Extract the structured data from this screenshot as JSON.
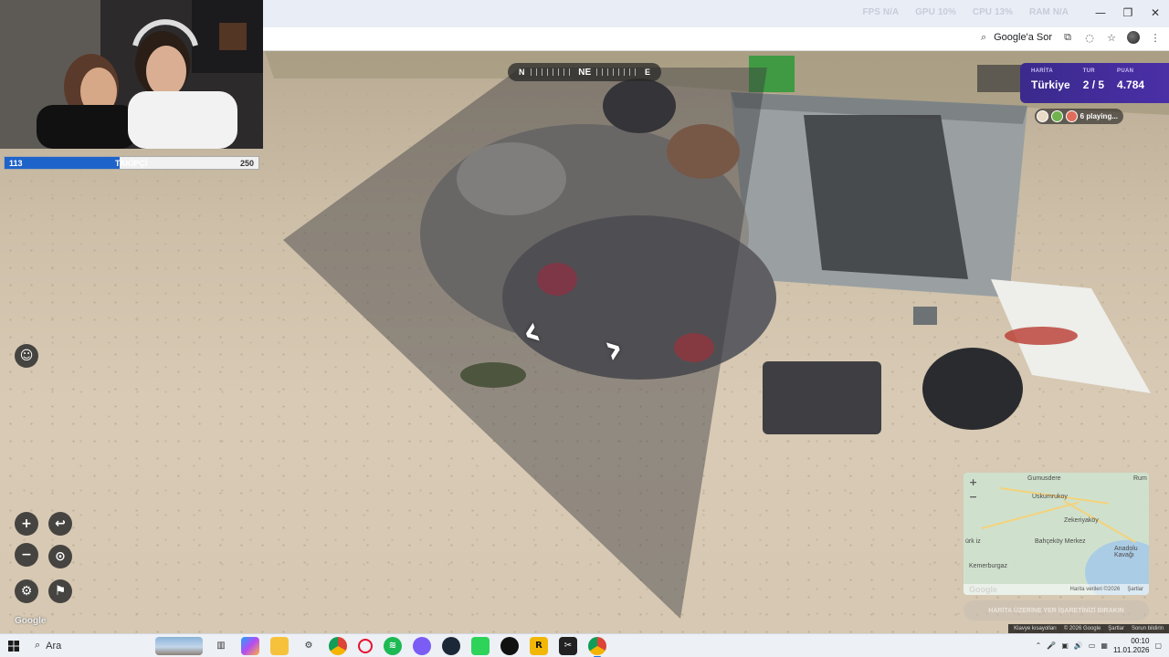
{
  "browser": {
    "perf": [
      {
        "label": "FPS",
        "value": "N/A"
      },
      {
        "label": "GPU",
        "value": "10%"
      },
      {
        "label": "CPU",
        "value": "13%"
      },
      {
        "label": "RAM",
        "value": "N/A"
      }
    ],
    "ask_google": "Google'a Sor"
  },
  "game": {
    "compass": {
      "left": "N",
      "center": "NE",
      "right": "E"
    },
    "score": {
      "map_label": "HARİTA",
      "map_value": "Türkiye",
      "round_label": "TUR",
      "round_value": "2 / 5",
      "points_label": "PUAN",
      "points_value": "4.784"
    },
    "playing": "6 playing...",
    "minimap": {
      "places": [
        "Gumusdere",
        "Rum",
        "Uskumrukoy",
        "Zekeriyaköy",
        "Bahçeköy Merkez",
        "Anadolu Kavağı",
        "Kemerburgaz",
        "ürk iz"
      ],
      "footer": [
        "Harita verileri ©2026",
        "Şartlar"
      ]
    },
    "guess_button": "HARİTA ÜZERİNE YER İŞARETİNİZİ BIRAKIN",
    "google_footer": [
      "Klavye kısayolları",
      "© 2026 Google",
      "Şartlar",
      "Sorun bildirin"
    ],
    "google_logo": "Google"
  },
  "stream": {
    "followers_current": "113",
    "followers_label": "TAKİPÇİ",
    "followers_target": "250",
    "progress_fraction": 0.452
  },
  "taskbar": {
    "search_label": "Ara",
    "time": "00:10",
    "date": "11.01.2026"
  },
  "colors": {
    "score_bg": "#4a2fa6",
    "follow_fill": "#1e63c9"
  }
}
